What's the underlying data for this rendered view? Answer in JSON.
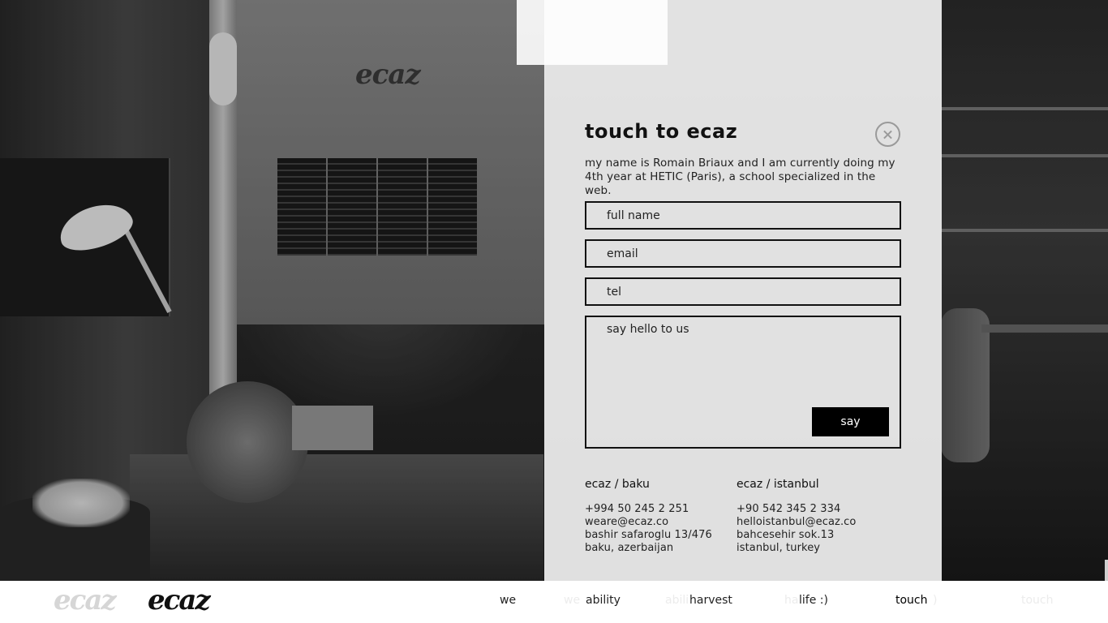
{
  "contact": {
    "title": "touch to ecaz",
    "intro": "my name is Romain Briaux and I am currently doing my 4th year at HETIC (Paris), a school specialized in the web.",
    "fields": {
      "full_name_placeholder": "full name",
      "email_placeholder": "email",
      "tel_placeholder": "tel",
      "message_placeholder": "say hello to us"
    },
    "submit_label": "say",
    "offices": [
      {
        "name": "ecaz / baku",
        "phone": "+994 50 245 2 251",
        "email": "weare@ecaz.co",
        "street": "bashir safaroglu 13/476",
        "city": "baku, azerbaijan"
      },
      {
        "name": "ecaz / istanbul",
        "phone": "+90 542 345 2 334",
        "email": "helloistanbul@ecaz.co",
        "street": "bahcesehir sok.13",
        "city": "istanbul, turkey"
      }
    ]
  },
  "background": {
    "wall_logo": "ecaz"
  },
  "nav": {
    "logo_ghost": "ecaz",
    "logo": "ecaz",
    "items": [
      {
        "label": "we",
        "ghost": "we"
      },
      {
        "label": "ability",
        "ghost": "abili"
      },
      {
        "label": "harvest",
        "ghost": "ha"
      },
      {
        "label": "life :)",
        "ghost": ")"
      },
      {
        "label": "touch",
        "ghost": "touch"
      }
    ],
    "active": "touch"
  },
  "colors": {
    "panel_bg": "#f0f0f0",
    "text": "#111111",
    "button_bg": "#000000",
    "button_text": "#ffffff",
    "close_icon": "#9a9a9a",
    "nav_ghost": "#ececec"
  }
}
